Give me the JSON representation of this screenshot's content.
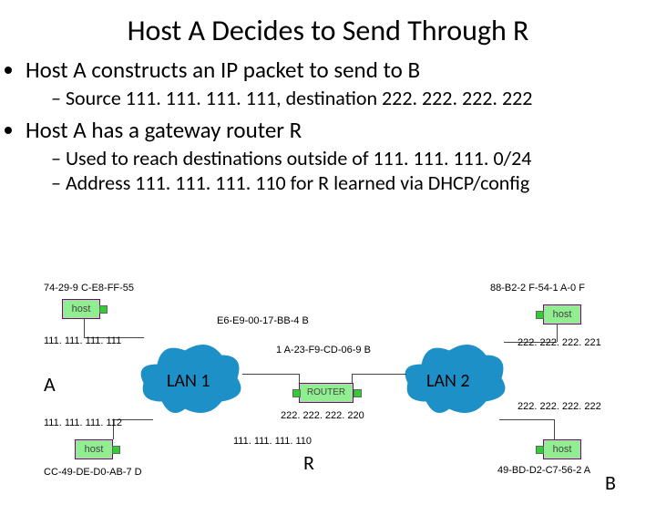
{
  "title": "Host A Decides to Send Through R",
  "bullets": {
    "b1": "Host A constructs an IP packet to send to B",
    "b1a": "Source 111. 111. 111. 111, destination 222. 222. 222. 222",
    "b2": "Host A has a gateway router R",
    "b2a": "Used to reach destinations outside of 111. 111. 111. 0/24",
    "b2b": "Address 111. 111. 111. 110 for R learned via DHCP/config"
  },
  "word": {
    "host": "host",
    "router": "ROUTER"
  },
  "mac": {
    "a": "74-29-9 C-E8-FF-55",
    "c": "CC-49-DE-D0-AB-7 D",
    "r_left": "E6-E9-00-17-BB-4 B",
    "r_right": "1 A-23-F9-CD-06-9 B",
    "d": "88-B2-2 F-54-1 A-0 F",
    "b": "49-BD-D2-C7-56-2 A"
  },
  "ip": {
    "a": "111. 111. 111. 111",
    "c": "111. 111. 111. 112",
    "r_left": "111. 111. 111. 110",
    "r_right": "222. 222. 222. 220",
    "d": "222. 222. 222. 221",
    "b": "222. 222. 222. 222"
  },
  "labels": {
    "A": "A",
    "B": "B",
    "R": "R",
    "LAN1": "LAN 1",
    "LAN2": "LAN 2"
  }
}
